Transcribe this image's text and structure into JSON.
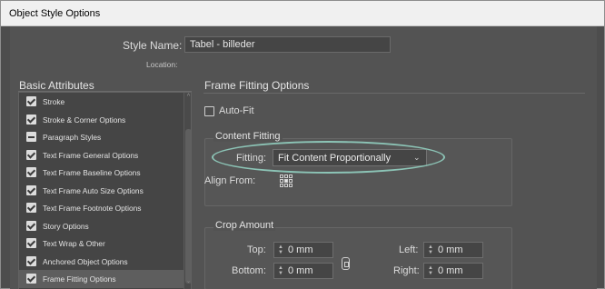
{
  "window": {
    "title": "Object Style Options"
  },
  "style_name": {
    "label": "Style Name:",
    "value": "Tabel - billeder"
  },
  "location": {
    "label": "Location:"
  },
  "basic_attributes": {
    "title": "Basic Attributes",
    "items": [
      {
        "label": "Stroke",
        "state": "checked",
        "selected": false
      },
      {
        "label": "Stroke & Corner Options",
        "state": "checked",
        "selected": false
      },
      {
        "label": "Paragraph Styles",
        "state": "mixed",
        "selected": false
      },
      {
        "label": "Text Frame General Options",
        "state": "checked",
        "selected": false
      },
      {
        "label": "Text Frame Baseline Options",
        "state": "checked",
        "selected": false
      },
      {
        "label": "Text Frame Auto Size Options",
        "state": "checked",
        "selected": false
      },
      {
        "label": "Text Frame Footnote Options",
        "state": "checked",
        "selected": false
      },
      {
        "label": "Story Options",
        "state": "checked",
        "selected": false
      },
      {
        "label": "Text Wrap & Other",
        "state": "checked",
        "selected": false
      },
      {
        "label": "Anchored Object Options",
        "state": "checked",
        "selected": false
      },
      {
        "label": "Frame Fitting Options",
        "state": "checked",
        "selected": true
      }
    ]
  },
  "frame_fitting": {
    "title": "Frame Fitting Options",
    "auto_fit": {
      "label": "Auto-Fit",
      "checked": false
    },
    "content_fitting": {
      "title": "Content Fitting",
      "fitting_label": "Fitting:",
      "fitting_value": "Fit Content Proportionally",
      "align_from_label": "Align From:",
      "align_from_selected": "center"
    },
    "crop_amount": {
      "title": "Crop Amount",
      "top": {
        "label": "Top:",
        "value": "0 mm"
      },
      "bottom": {
        "label": "Bottom:",
        "value": "0 mm"
      },
      "left": {
        "label": "Left:",
        "value": "0 mm"
      },
      "right": {
        "label": "Right:",
        "value": "0 mm"
      }
    }
  },
  "colors": {
    "dialog_bg": "#535353",
    "highlight_ring": "#8cc4b6",
    "titlebar_bg": "#f0f0f0"
  }
}
